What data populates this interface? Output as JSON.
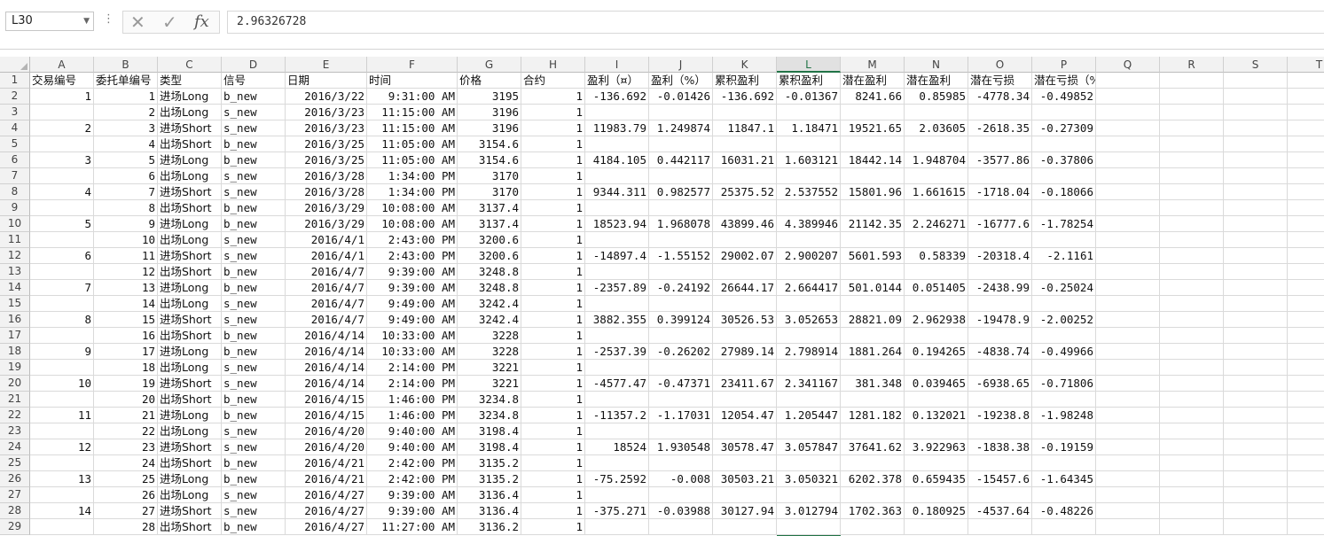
{
  "namebox": "L30",
  "formula": "2.96326728",
  "icons": {
    "cancel": "x-icon",
    "enter": "check-icon",
    "function": "fx-icon"
  },
  "active_column": "L",
  "accent_color": "#217346",
  "columns": [
    "A",
    "B",
    "C",
    "D",
    "E",
    "F",
    "G",
    "H",
    "I",
    "J",
    "K",
    "L",
    "M",
    "N",
    "O",
    "P",
    "Q",
    "R",
    "S",
    "T"
  ],
  "header_row": [
    "交易编号",
    "委托单编号",
    "类型",
    "信号",
    "日期",
    "时间",
    "价格",
    "合约",
    "盈利（¤）",
    "盈利（%）",
    "累积盈利",
    "累积盈利",
    "潜在盈利",
    "潜在盈利",
    "潜在亏损",
    "潜在亏损（%）"
  ],
  "rows": [
    [
      "1",
      "1",
      "进场Long",
      "b_new",
      "2016/3/22",
      "9:31:00 AM",
      "3195",
      "1",
      "-136.692",
      "-0.01426",
      "-136.692",
      "-0.01367",
      "8241.66",
      "0.85985",
      "-4778.34",
      "-0.49852"
    ],
    [
      "",
      "2",
      "出场Long",
      "s_new",
      "2016/3/23",
      "11:15:00 AM",
      "3196",
      "1",
      "",
      "",
      "",
      "",
      "",
      "",
      "",
      ""
    ],
    [
      "2",
      "3",
      "进场Short",
      "s_new",
      "2016/3/23",
      "11:15:00 AM",
      "3196",
      "1",
      "11983.79",
      "1.249874",
      "11847.1",
      "1.18471",
      "19521.65",
      "2.03605",
      "-2618.35",
      "-0.27309"
    ],
    [
      "",
      "4",
      "出场Short",
      "b_new",
      "2016/3/25",
      "11:05:00 AM",
      "3154.6",
      "1",
      "",
      "",
      "",
      "",
      "",
      "",
      "",
      ""
    ],
    [
      "3",
      "5",
      "进场Long",
      "b_new",
      "2016/3/25",
      "11:05:00 AM",
      "3154.6",
      "1",
      "4184.105",
      "0.442117",
      "16031.21",
      "1.603121",
      "18442.14",
      "1.948704",
      "-3577.86",
      "-0.37806"
    ],
    [
      "",
      "6",
      "出场Long",
      "s_new",
      "2016/3/28",
      "1:34:00 PM",
      "3170",
      "1",
      "",
      "",
      "",
      "",
      "",
      "",
      "",
      ""
    ],
    [
      "4",
      "7",
      "进场Short",
      "s_new",
      "2016/3/28",
      "1:34:00 PM",
      "3170",
      "1",
      "9344.311",
      "0.982577",
      "25375.52",
      "2.537552",
      "15801.96",
      "1.661615",
      "-1718.04",
      "-0.18066"
    ],
    [
      "",
      "8",
      "出场Short",
      "b_new",
      "2016/3/29",
      "10:08:00 AM",
      "3137.4",
      "1",
      "",
      "",
      "",
      "",
      "",
      "",
      "",
      ""
    ],
    [
      "5",
      "9",
      "进场Long",
      "b_new",
      "2016/3/29",
      "10:08:00 AM",
      "3137.4",
      "1",
      "18523.94",
      "1.968078",
      "43899.46",
      "4.389946",
      "21142.35",
      "2.246271",
      "-16777.6",
      "-1.78254"
    ],
    [
      "",
      "10",
      "出场Long",
      "s_new",
      "2016/4/1",
      "2:43:00 PM",
      "3200.6",
      "1",
      "",
      "",
      "",
      "",
      "",
      "",
      "",
      ""
    ],
    [
      "6",
      "11",
      "进场Short",
      "s_new",
      "2016/4/1",
      "2:43:00 PM",
      "3200.6",
      "1",
      "-14897.4",
      "-1.55152",
      "29002.07",
      "2.900207",
      "5601.593",
      "0.58339",
      "-20318.4",
      "-2.1161"
    ],
    [
      "",
      "12",
      "出场Short",
      "b_new",
      "2016/4/7",
      "9:39:00 AM",
      "3248.8",
      "1",
      "",
      "",
      "",
      "",
      "",
      "",
      "",
      ""
    ],
    [
      "7",
      "13",
      "进场Long",
      "b_new",
      "2016/4/7",
      "9:39:00 AM",
      "3248.8",
      "1",
      "-2357.89",
      "-0.24192",
      "26644.17",
      "2.664417",
      "501.0144",
      "0.051405",
      "-2438.99",
      "-0.25024"
    ],
    [
      "",
      "14",
      "出场Long",
      "s_new",
      "2016/4/7",
      "9:49:00 AM",
      "3242.4",
      "1",
      "",
      "",
      "",
      "",
      "",
      "",
      "",
      ""
    ],
    [
      "8",
      "15",
      "进场Short",
      "s_new",
      "2016/4/7",
      "9:49:00 AM",
      "3242.4",
      "1",
      "3882.355",
      "0.399124",
      "30526.53",
      "3.052653",
      "28821.09",
      "2.962938",
      "-19478.9",
      "-2.00252"
    ],
    [
      "",
      "16",
      "出场Short",
      "b_new",
      "2016/4/14",
      "10:33:00 AM",
      "3228",
      "1",
      "",
      "",
      "",
      "",
      "",
      "",
      "",
      ""
    ],
    [
      "9",
      "17",
      "进场Long",
      "b_new",
      "2016/4/14",
      "10:33:00 AM",
      "3228",
      "1",
      "-2537.39",
      "-0.26202",
      "27989.14",
      "2.798914",
      "1881.264",
      "0.194265",
      "-4838.74",
      "-0.49966"
    ],
    [
      "",
      "18",
      "出场Long",
      "s_new",
      "2016/4/14",
      "2:14:00 PM",
      "3221",
      "1",
      "",
      "",
      "",
      "",
      "",
      "",
      "",
      ""
    ],
    [
      "10",
      "19",
      "进场Short",
      "s_new",
      "2016/4/14",
      "2:14:00 PM",
      "3221",
      "1",
      "-4577.47",
      "-0.47371",
      "23411.67",
      "2.341167",
      "381.348",
      "0.039465",
      "-6938.65",
      "-0.71806"
    ],
    [
      "",
      "20",
      "出场Short",
      "b_new",
      "2016/4/15",
      "1:46:00 PM",
      "3234.8",
      "1",
      "",
      "",
      "",
      "",
      "",
      "",
      "",
      ""
    ],
    [
      "11",
      "21",
      "进场Long",
      "b_new",
      "2016/4/15",
      "1:46:00 PM",
      "3234.8",
      "1",
      "-11357.2",
      "-1.17031",
      "12054.47",
      "1.205447",
      "1281.182",
      "0.132021",
      "-19238.8",
      "-1.98248"
    ],
    [
      "",
      "22",
      "出场Long",
      "s_new",
      "2016/4/20",
      "9:40:00 AM",
      "3198.4",
      "1",
      "",
      "",
      "",
      "",
      "",
      "",
      "",
      ""
    ],
    [
      "12",
      "23",
      "进场Short",
      "s_new",
      "2016/4/20",
      "9:40:00 AM",
      "3198.4",
      "1",
      "18524",
      "1.930548",
      "30578.47",
      "3.057847",
      "37641.62",
      "3.922963",
      "-1838.38",
      "-0.19159"
    ],
    [
      "",
      "24",
      "出场Short",
      "b_new",
      "2016/4/21",
      "2:42:00 PM",
      "3135.2",
      "1",
      "",
      "",
      "",
      "",
      "",
      "",
      "",
      ""
    ],
    [
      "13",
      "25",
      "进场Long",
      "b_new",
      "2016/4/21",
      "2:42:00 PM",
      "3135.2",
      "1",
      "-75.2592",
      "-0.008",
      "30503.21",
      "3.050321",
      "6202.378",
      "0.659435",
      "-15457.6",
      "-1.64345"
    ],
    [
      "",
      "26",
      "出场Long",
      "s_new",
      "2016/4/27",
      "9:39:00 AM",
      "3136.4",
      "1",
      "",
      "",
      "",
      "",
      "",
      "",
      "",
      ""
    ],
    [
      "14",
      "27",
      "进场Short",
      "s_new",
      "2016/4/27",
      "9:39:00 AM",
      "3136.4",
      "1",
      "-375.271",
      "-0.03988",
      "30127.94",
      "3.012794",
      "1702.363",
      "0.180925",
      "-4537.64",
      "-0.48226"
    ],
    [
      "",
      "28",
      "出场Short",
      "b_new",
      "2016/4/27",
      "11:27:00 AM",
      "3136.2",
      "1",
      "",
      "",
      "",
      "",
      "",
      "",
      "",
      ""
    ]
  ]
}
